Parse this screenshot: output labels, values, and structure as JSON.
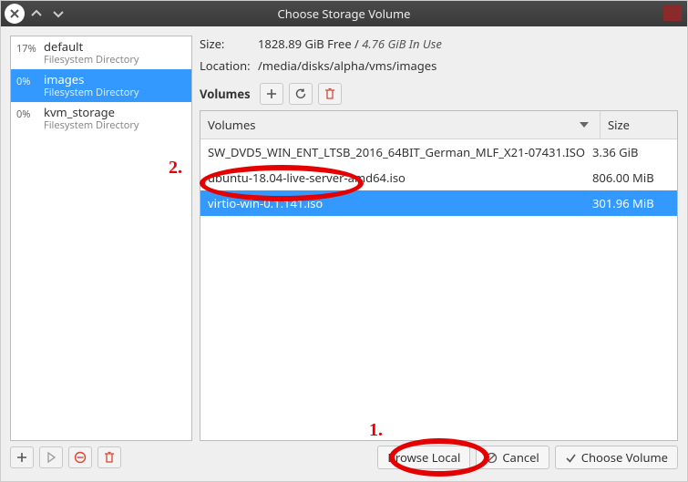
{
  "window": {
    "title": "Choose Storage Volume"
  },
  "sidebar": {
    "pools": [
      {
        "percent": "17%",
        "name": "default",
        "sub": "Filesystem Directory",
        "selected": false
      },
      {
        "percent": "0%",
        "name": "images",
        "sub": "Filesystem Directory",
        "selected": true
      },
      {
        "percent": "0%",
        "name": "kvm_storage",
        "sub": "Filesystem Directory",
        "selected": false
      }
    ]
  },
  "info": {
    "size_label": "Size:",
    "size_free": "1828.89 GiB Free",
    "size_inuse": "4.76 GiB In Use",
    "sep": " / ",
    "location_label": "Location:",
    "location_value": "/media/disks/alpha/vms/images"
  },
  "vol_toolbar": {
    "label": "Volumes",
    "add": "add-volume",
    "refresh": "refresh-volumes",
    "delete": "delete-volume"
  },
  "table": {
    "headers": {
      "volumes": "Volumes",
      "size": "Size"
    },
    "rows": [
      {
        "name": "SW_DVD5_WIN_ENT_LTSB_2016_64BIT_German_MLF_X21-07431.ISO",
        "size": "3.36 GiB",
        "selected": false
      },
      {
        "name": "ubuntu-18.04-live-server-amd64.iso",
        "size": "806.00 MiB",
        "selected": false
      },
      {
        "name": "virtio-win-0.1.141.iso",
        "size": "301.96 MiB",
        "selected": true
      }
    ]
  },
  "bottom": {
    "add": "add-pool",
    "start": "start-pool",
    "stop": "stop-pool",
    "delete": "delete-pool",
    "browse_local": "Browse Local",
    "cancel": "Cancel",
    "choose": "Choose Volume"
  },
  "annotations": {
    "one": "1.",
    "two": "2."
  }
}
